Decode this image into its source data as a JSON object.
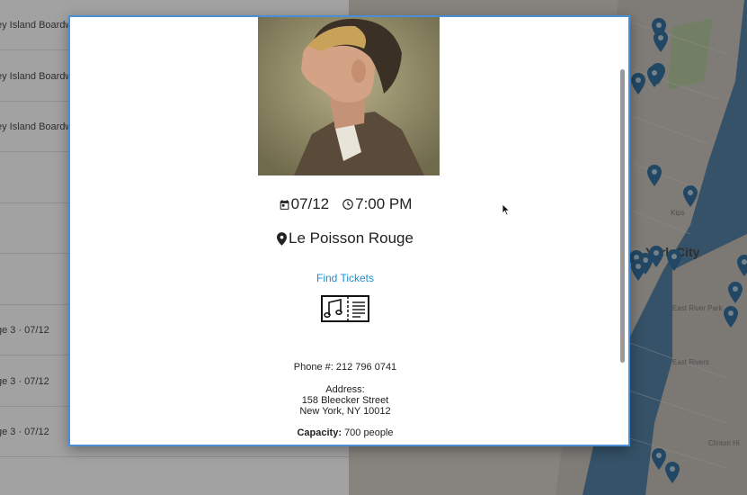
{
  "list": {
    "rows": [
      {
        "text": "ey Island Boardw"
      },
      {
        "text": "ey Island Boardw"
      },
      {
        "text": "ey Island Boardw"
      },
      {
        "text": ""
      },
      {
        "text": ""
      },
      {
        "text": ""
      },
      {
        "text": "ge 3 · 07/12"
      },
      {
        "text": "ge 3 · 07/12"
      },
      {
        "text": "ge 3 · 07/12"
      }
    ]
  },
  "map": {
    "city_label": "York City",
    "labels": [
      "Kips",
      "East River Park",
      "East Rivers",
      "Clinton Hi"
    ]
  },
  "modal": {
    "date": "07/12",
    "time": "7:00 PM",
    "venue": "Le Poisson Rouge",
    "tickets_link": "Find Tickets",
    "phone": "Phone #: 212 796 0741",
    "address_label": "Address:",
    "address_line1": "158 Bleecker Street",
    "address_line2": "New York, NY 10012",
    "capacity_label": "Capacity:",
    "capacity_value": "700 people"
  },
  "icons": {
    "calendar": "calendar-icon",
    "clock": "clock-icon",
    "location": "map-pin-icon",
    "ticket": "music-ticket-icon",
    "map_marker": "map-marker-icon"
  },
  "colors": {
    "accent_link": "#1a8fd8",
    "modal_border": "#4a8fd6",
    "map_marker": "#1f5c8c",
    "water": "#3f6f93"
  }
}
